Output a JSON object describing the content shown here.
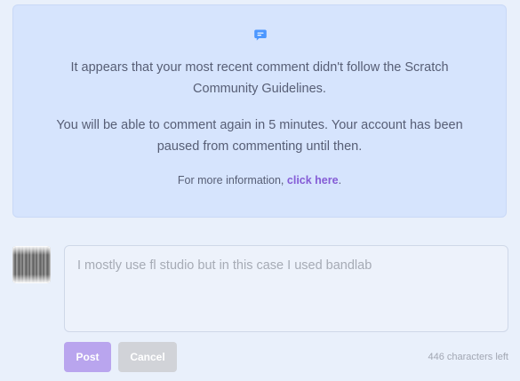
{
  "notice": {
    "icon": "speech-bubble-icon",
    "line1": "It appears that your most recent comment didn't follow the Scratch",
    "line2": "Community Guidelines.",
    "line3": "You will be able to comment again in 5 minutes. Your account has been",
    "line4": "paused from commenting until then.",
    "more_prefix": "For more information, ",
    "more_link": "click here",
    "more_suffix": "."
  },
  "comment": {
    "avatar": "user-avatar",
    "placeholder": "I mostly use fl studio but in this case I used bandlab"
  },
  "actions": {
    "post_label": "Post",
    "cancel_label": "Cancel"
  },
  "chars_left": "446 characters left",
  "colors": {
    "notice_bg": "#d6e4fd",
    "link": "#855cd6",
    "post_button": "#b9a5ee",
    "cancel_button": "#d1d3d8",
    "icon": "#4c97ff"
  }
}
